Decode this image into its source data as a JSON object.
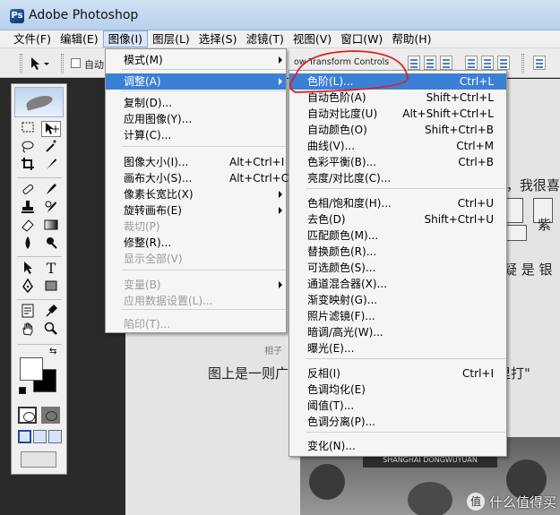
{
  "window": {
    "title": "Adobe Photoshop",
    "app_icon": "photoshop-logo"
  },
  "menubar": [
    {
      "label": "文件(F)"
    },
    {
      "label": "编辑(E)"
    },
    {
      "label": "图像(I)"
    },
    {
      "label": "图层(L)"
    },
    {
      "label": "选择(S)"
    },
    {
      "label": "滤镜(T)"
    },
    {
      "label": "视图(V)"
    },
    {
      "label": "窗口(W)"
    },
    {
      "label": "帮助(H)"
    }
  ],
  "options_bar": {
    "auto_select_label": "自动",
    "transform_controls_label": "ow Transform Controls"
  },
  "image_menu": {
    "items": [
      {
        "label": "模式(M)",
        "shortcut": "",
        "submenu": true,
        "disabled": false
      },
      {
        "label": "调整(A)",
        "shortcut": "",
        "submenu": true,
        "disabled": false,
        "highlighted": true
      },
      {
        "label": "复制(D)...",
        "shortcut": "",
        "disabled": false
      },
      {
        "label": "应用图像(Y)...",
        "shortcut": "",
        "disabled": false
      },
      {
        "label": "计算(C)...",
        "shortcut": "",
        "disabled": false
      },
      {
        "label": "图像大小(I)...",
        "shortcut": "Alt+Ctrl+I",
        "disabled": false
      },
      {
        "label": "画布大小(S)...",
        "shortcut": "Alt+Ctrl+C",
        "disabled": false
      },
      {
        "label": "像素长宽比(X)",
        "shortcut": "",
        "submenu": true,
        "disabled": false
      },
      {
        "label": "旋转画布(E)",
        "shortcut": "",
        "submenu": true,
        "disabled": false
      },
      {
        "label": "裁切(P)",
        "shortcut": "",
        "disabled": true
      },
      {
        "label": "修整(R)...",
        "shortcut": "",
        "disabled": false
      },
      {
        "label": "显示全部(V)",
        "shortcut": "",
        "disabled": true
      },
      {
        "label": "变量(B)",
        "shortcut": "",
        "submenu": true,
        "disabled": true
      },
      {
        "label": "应用数据设置(L)...",
        "shortcut": "",
        "disabled": true
      },
      {
        "label": "陷印(T)...",
        "shortcut": "",
        "disabled": true
      }
    ]
  },
  "adjust_menu": {
    "items": [
      {
        "label": "色阶(L)...",
        "shortcut": "Ctrl+L",
        "highlighted": true
      },
      {
        "label": "自动色阶(A)",
        "shortcut": "Shift+Ctrl+L"
      },
      {
        "label": "自动对比度(U)",
        "shortcut": "Alt+Shift+Ctrl+L"
      },
      {
        "label": "自动颜色(O)",
        "shortcut": "Shift+Ctrl+B"
      },
      {
        "label": "曲线(V)...",
        "shortcut": "Ctrl+M"
      },
      {
        "label": "色彩平衡(B)...",
        "shortcut": "Ctrl+B"
      },
      {
        "label": "亮度/对比度(C)...",
        "shortcut": ""
      },
      {
        "label": "色相/饱和度(H)...",
        "shortcut": "Ctrl+U"
      },
      {
        "label": "去色(D)",
        "shortcut": "Shift+Ctrl+U"
      },
      {
        "label": "匹配颜色(M)...",
        "shortcut": ""
      },
      {
        "label": "替换颜色(R)...",
        "shortcut": ""
      },
      {
        "label": "可选颜色(S)...",
        "shortcut": ""
      },
      {
        "label": "通道混合器(X)...",
        "shortcut": ""
      },
      {
        "label": "渐变映射(G)...",
        "shortcut": ""
      },
      {
        "label": "照片滤镜(F)...",
        "shortcut": ""
      },
      {
        "label": "暗调/高光(W)...",
        "shortcut": ""
      },
      {
        "label": "曝光(E)...",
        "shortcut": ""
      },
      {
        "label": "反相(I)",
        "shortcut": "Ctrl+I"
      },
      {
        "label": "色调均化(E)",
        "shortcut": ""
      },
      {
        "label": "阈值(T)...",
        "shortcut": ""
      },
      {
        "label": "色调分离(P)...",
        "shortcut": ""
      },
      {
        "label": "变化(N)...",
        "shortcut": ""
      }
    ]
  },
  "document": {
    "lines": [
      {
        "text": "\"，我很喜"
      },
      {
        "text": "紫"
      },
      {
        "text": "疑 是 银"
      },
      {
        "text": "图上是一则广"
      },
      {
        "text": "号里打\""
      },
      {
        "text": "相子"
      }
    ],
    "poster_banner": "SHANGHAI DONGWUYUAN"
  },
  "watermark": {
    "text": "什么值得买",
    "icon": "zhi-logo",
    "glyph": "值"
  },
  "colors": {
    "highlight": "#3b80d6",
    "annotation": "#e0201c",
    "menu_bg": "#f5f5f5"
  }
}
